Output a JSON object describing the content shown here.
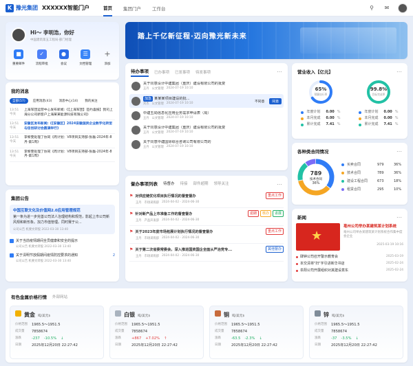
{
  "header": {
    "logo_text": "豫光集团",
    "portal_title": "XXXXXX智能门户",
    "tabs": [
      "首页",
      "集团门户",
      "工作台"
    ]
  },
  "profile": {
    "greeting": "Hi～ 李明浩，你好",
    "org": "中国建筑第五工程局·部门经理",
    "apps": [
      "重要邮件",
      "流程审批",
      "会议",
      "文档管理",
      "添加"
    ]
  },
  "messages": {
    "title": "我的消息",
    "tabs": [
      "全部(57)",
      "应用消息(43)",
      "消息中心(14)",
      "我的关注"
    ],
    "items": [
      {
        "time": "13:51",
        "day": "今天",
        "text": "上海军团运营中心发布新闻:《【上海军团】签约喜报】我司上海分公司新客户上海某某能源科技有限公司》",
        "bold": false
      },
      {
        "time": "13:51",
        "day": "今天",
        "text": "安徽区发布新闻:《【安徽区】2024安徽国资企业数字化转型与信创研讨会圆满举行》",
        "bold": true
      },
      {
        "time": "13:51",
        "day": "今天",
        "text": "李黎雯处理了协同《周计划：V8项目支持部-张磊-2024年-8月-第1周》",
        "bold": false
      },
      {
        "time": "13:51",
        "day": "今天",
        "text": "李黎雯处理了协同《周计划：V8项目支持部-张磊-2024年-8月-第1周》",
        "bold": false
      }
    ]
  },
  "banner": {
    "text": "踏上千亿新征程·迈向豫光新未来"
  },
  "todo": {
    "title": "待办事项",
    "tabs": [
      "已办事项",
      "已发事项",
      "待发事项"
    ],
    "items": [
      {
        "title": "关于同意设计中建集团（重庆）建设有限公司的批复",
        "person": "王丹",
        "dept": "公文管理",
        "time": "2024-07-19 10:10",
        "highlight": false
      },
      {
        "title": "某某某项目建设的批...",
        "person": "刘杰",
        "dept": "公文管理",
        "time": "2024-07-19 10:10",
        "highlight": true,
        "tag": "加急",
        "reject": "不同意",
        "agree": "同意"
      },
      {
        "title": "中建五局信息化应用业务需求申请表（局）",
        "person": "王丹",
        "dept": "公文管理",
        "time": "2024-07-19 10:10",
        "highlight": false
      },
      {
        "title": "关于同意设计中建集团（重庆）建设有限公司的批复",
        "person": "王丹",
        "dept": "公文管理",
        "time": "2024-07-19 10:10",
        "highlight": false
      },
      {
        "title": "关于同意中建国际综合咨询公司有限公司的",
        "person": "王丹",
        "dept": "公文管理",
        "time": "2024-07-19 10:10",
        "highlight": false
      }
    ]
  },
  "revenue": {
    "title": "营业收入【亿元】",
    "gauges": [
      {
        "value": "65%",
        "label": "预算执行率",
        "color": "#2f7cf6"
      },
      {
        "value": "99.8%",
        "label": "目标完成率",
        "color": "#22c1a5"
      }
    ],
    "stats": [
      [
        {
          "label": "年度计划",
          "value": "0.00",
          "unit": "%"
        },
        {
          "label": "本月完成",
          "value": "0.00",
          "unit": "%"
        },
        {
          "label": "累计完成",
          "value": "7.41",
          "unit": "%"
        }
      ],
      [
        {
          "label": "年度计划",
          "value": "0.00",
          "unit": "%"
        },
        {
          "label": "本月完成",
          "value": "0.00",
          "unit": "%"
        },
        {
          "label": "累计完成",
          "value": "7.41",
          "unit": "%"
        }
      ]
    ]
  },
  "contracts": {
    "title": "各种类合同情况",
    "center_value": "789",
    "center_label": "技术合同",
    "center_pct": "36%",
    "legend": [
      {
        "name": "买卖合同",
        "count": "979",
        "pct": "36%",
        "color": "#2f7cf6"
      },
      {
        "name": "技术合同",
        "count": "789",
        "pct": "36%",
        "color": "#f5a623"
      },
      {
        "name": "建设工程合同",
        "count": "673",
        "pct": "18%",
        "color": "#22c1a5"
      },
      {
        "name": "租赁合同",
        "count": "295",
        "pct": "10%",
        "color": "#7b6cf6"
      }
    ]
  },
  "announce": {
    "title": "集团公告",
    "feature_title": "中国互联文化及价值网2.0应用管理规范",
    "feature_text": "第一条为进一步完善公司法人治理结构和规范，影起上市公司新风规和新形象。加力市值管理。同时赛于公...",
    "feature_meta": "公司公告  机要文转股  2022-03-30 13:40",
    "items": [
      {
        "text": "关于当前疫情期间全员健康和安全的提示",
        "meta": "公司公告  机要文转股  2022-03-30 13:40"
      },
      {
        "text": "关于清明节放假期间疫情防控要求的通知",
        "meta": "公司公告  机要文转股  2022-03-30 13:40",
        "count": "2"
      }
    ]
  },
  "supervise": {
    "title": "督办事项列表",
    "tabs": [
      "待督办",
      "待接",
      "部件超期",
      "领导关注"
    ],
    "items": [
      {
        "title": "对供应链优化项目执行情况的督查督办",
        "tag": "重点工作",
        "tagc": "#e23b3b",
        "person": "王丹",
        "dept": "市场采购部",
        "range": "2024-04-02 - 2024-06-30"
      },
      {
        "title": "针对新产品上市准备工作的督查督办",
        "tag": "逾期",
        "tagc": "#e23b3b",
        "tag2": "核办",
        "tag3": "进展",
        "person": "王丹",
        "dept": "产品开发部",
        "range": "2024-04-02 - 2024-06-30"
      },
      {
        "title": "关于2023年度市场拓展计划执行情况的督查督办",
        "tag": "重点工作",
        "tagc": "#e23b3b",
        "person": "王丹",
        "dept": "市场采购部",
        "range": "2024-04-02 - 2024-06-30"
      },
      {
        "title": "关于第二次省委常委会，深入推进国资国企全面从严治党专...",
        "tag": "其他督办",
        "tagc": "#1a5fd0",
        "person": "王丹",
        "dept": "市场采购部",
        "range": "2024-04-02 - 2024-06-30"
      }
    ]
  },
  "news": {
    "title": "新闻",
    "feature_title": "亳州公司举办某建筑某计划系统",
    "feature_sub": "亳州公司举办某建筑某计划系统合作集中度会企业",
    "feature_date": "2025-03-19 10:16",
    "items": [
      {
        "text": "肆钟公司召开警示教育会",
        "date": "2025-03-19"
      },
      {
        "text": "本交清将\"扫\"字引进新华书店",
        "date": "2025-02-24"
      },
      {
        "text": "阜阳公司开展组织对其建设意东",
        "date": "2025-02-24"
      }
    ]
  },
  "metals": {
    "title": "有色金属价格行情",
    "tab2": "外部网站",
    "cards": [
      {
        "name": "黄金",
        "unit": "吨/美元$",
        "range": "1965.5～1951.5",
        "volume": "7858674",
        "change": "-237",
        "pct": "-10.5%",
        "dir": "down",
        "time": "2025年12月20日 22:27:42"
      },
      {
        "name": "白银",
        "unit": "吨/美元$",
        "range": "1965.5～1951.5",
        "volume": "7858674",
        "change": "+867",
        "pct": "+7.02%",
        "dir": "up",
        "time": "2025年12月20日 22:27:42"
      },
      {
        "name": "铜",
        "unit": "吨/美元$",
        "range": "1965.5～1951.5",
        "volume": "7858674",
        "change": "-63.5",
        "pct": "-2.3%",
        "dir": "down",
        "time": "2025年12月20日 22:27:42"
      },
      {
        "name": "锌",
        "unit": "吨/美元$",
        "range": "1965.5～1951.5",
        "volume": "7858674",
        "change": "-37",
        "pct": "-3.5%",
        "dir": "down",
        "time": "2025年12月20日 22:27:42"
      }
    ],
    "labels": {
      "range": "价格范围",
      "volume": "成交量",
      "change": "涨跌",
      "time": "日期"
    }
  }
}
